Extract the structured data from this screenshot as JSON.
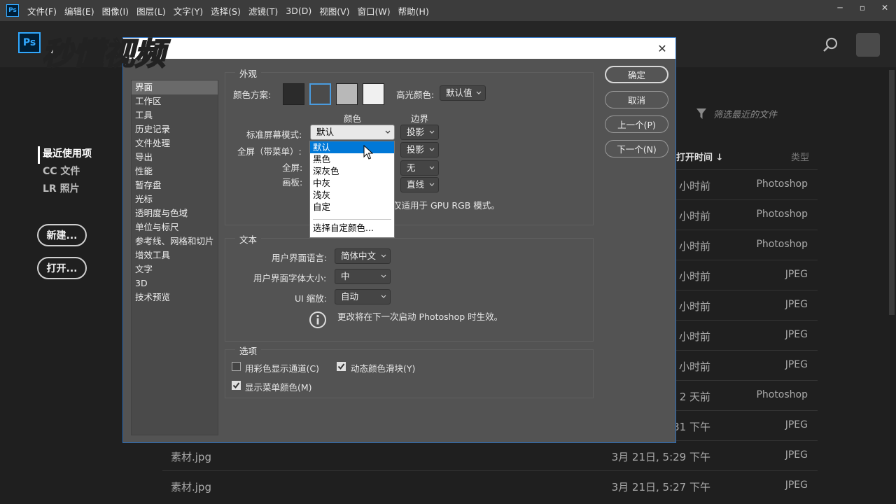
{
  "menubar": {
    "app_badge": "Ps",
    "items": [
      "文件(F)",
      "编辑(E)",
      "图像(I)",
      "图层(L)",
      "文字(Y)",
      "选择(S)",
      "滤镜(T)",
      "3D(D)",
      "视图(V)",
      "窗口(W)",
      "帮助(H)"
    ]
  },
  "home": {
    "logo": "Ps",
    "watermark_text": "秒懂视频",
    "nav": [
      "最近使用项",
      "CC 文件",
      "LR 照片"
    ],
    "new_button": "新建...",
    "open_button": "打开...",
    "filter_placeholder": "筛选最近的文件",
    "col_time": "打开时间",
    "col_type": "类型",
    "rows": [
      {
        "name": "",
        "time": "小时前",
        "type": "Photoshop"
      },
      {
        "name": "",
        "time": "小时前",
        "type": "Photoshop"
      },
      {
        "name": "",
        "time": "小时前",
        "type": "Photoshop"
      },
      {
        "name": "",
        "time": "小时前",
        "type": "JPEG"
      },
      {
        "name": "",
        "time": "小时前",
        "type": "JPEG"
      },
      {
        "name": "",
        "time": "小时前",
        "type": "JPEG"
      },
      {
        "name": "",
        "time": "小时前",
        "type": "JPEG"
      },
      {
        "name": "",
        "time": "2 天前",
        "type": "Photoshop"
      },
      {
        "name": "",
        "time": "31 下午",
        "type": "JPEG"
      },
      {
        "name": "素材.jpg",
        "time": "3月 21日, 5:29 下午",
        "type": "JPEG"
      },
      {
        "name": "素材.jpg",
        "time": "3月 21日, 5:27 下午",
        "type": "JPEG"
      }
    ]
  },
  "dialog": {
    "categories": [
      "界面",
      "工作区",
      "工具",
      "历史记录",
      "文件处理",
      "导出",
      "性能",
      "暂存盘",
      "光标",
      "透明度与色域",
      "单位与标尺",
      "参考线、网格和切片",
      "增效工具",
      "文字",
      "3D",
      "技术预览"
    ],
    "appearance": {
      "title": "外观",
      "color_scheme_label": "颜色方案:",
      "highlight_label": "高光颜色:",
      "highlight_value": "默认值",
      "col_color": "颜色",
      "col_border": "边界",
      "std_screen_label": "标准屏幕模式:",
      "std_screen_value": "默认",
      "std_screen_border": "投影",
      "full_menu_label": "全屏（带菜单）:",
      "full_menu_border": "投影",
      "full_label": "全屏:",
      "full_border": "无",
      "artboard_label": "画板:",
      "artboard_border": "直线",
      "note": "仅适用于 GPU RGB 模式。"
    },
    "dropdown_options": [
      "默认",
      "黑色",
      "深灰色",
      "中灰",
      "浅灰",
      "自定"
    ],
    "dropdown_custom": "选择自定颜色...",
    "text": {
      "title": "文本",
      "lang_label": "用户界面语言:",
      "lang_value": "简体中文",
      "size_label": "用户界面字体大小:",
      "size_value": "中",
      "scale_label": "UI 缩放:",
      "scale_value": "自动",
      "restart_note": "更改将在下一次启动 Photoshop 时生效。"
    },
    "options": {
      "title": "选项",
      "color_channels": "用彩色显示通道(C)",
      "dynamic_sliders": "动态颜色滑块(Y)",
      "menu_colors": "显示菜单颜色(M)"
    },
    "buttons": {
      "ok": "确定",
      "cancel": "取消",
      "prev": "上一个(P)",
      "next": "下一个(N)"
    }
  }
}
